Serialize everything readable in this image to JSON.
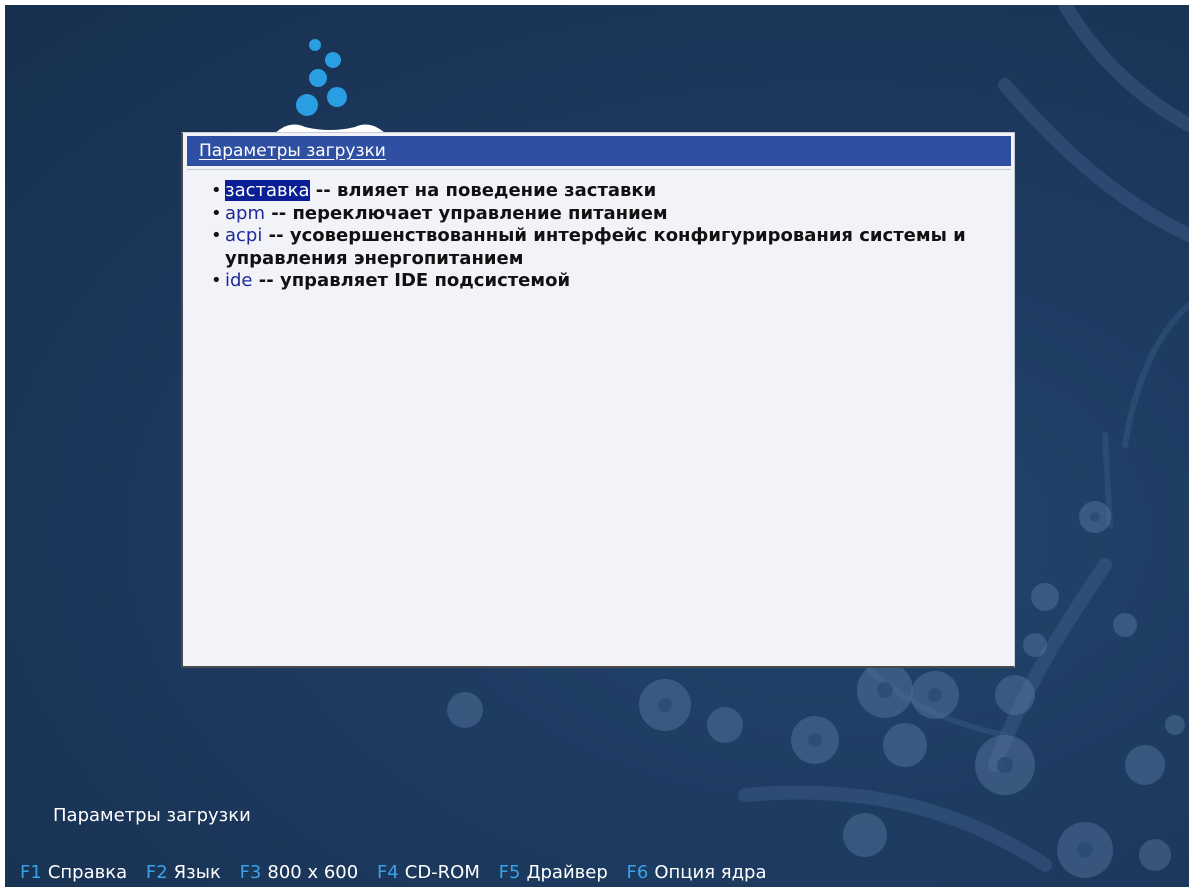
{
  "dialog": {
    "title": "Параметры загрузки",
    "items": [
      {
        "keyword": "заставка",
        "separator": " -- ",
        "description": "влияет на поведение заставки",
        "selected": true
      },
      {
        "keyword": "apm",
        "separator": " -- ",
        "description": "переключает управление питанием",
        "selected": false
      },
      {
        "keyword": "acpi",
        "separator": " -- ",
        "description": "усовершенствованный интерфейс конфигурирования системы и управления энергопитанием",
        "selected": false
      },
      {
        "keyword": "ide",
        "separator": " -- ",
        "description": "управляет IDE подсистемой",
        "selected": false
      }
    ]
  },
  "status": {
    "label": "Параметры загрузки"
  },
  "function_keys": [
    {
      "key": "F1",
      "label": "Справка"
    },
    {
      "key": "F2",
      "label": "Язык"
    },
    {
      "key": "F3",
      "label": "800 x 600"
    },
    {
      "key": "F4",
      "label": "CD-ROM"
    },
    {
      "key": "F5",
      "label": "Драйвер"
    },
    {
      "key": "F6",
      "label": "Опция ядра"
    }
  ],
  "colors": {
    "background": "#1d3a60",
    "title_bar": "#2f4fa3",
    "dialog_bg": "#f2f3f9",
    "keyword": "#1f2a9a",
    "selection": "#0a1f96",
    "fkey": "#3aa3e8",
    "logo_dots": "#2a9ee2"
  }
}
